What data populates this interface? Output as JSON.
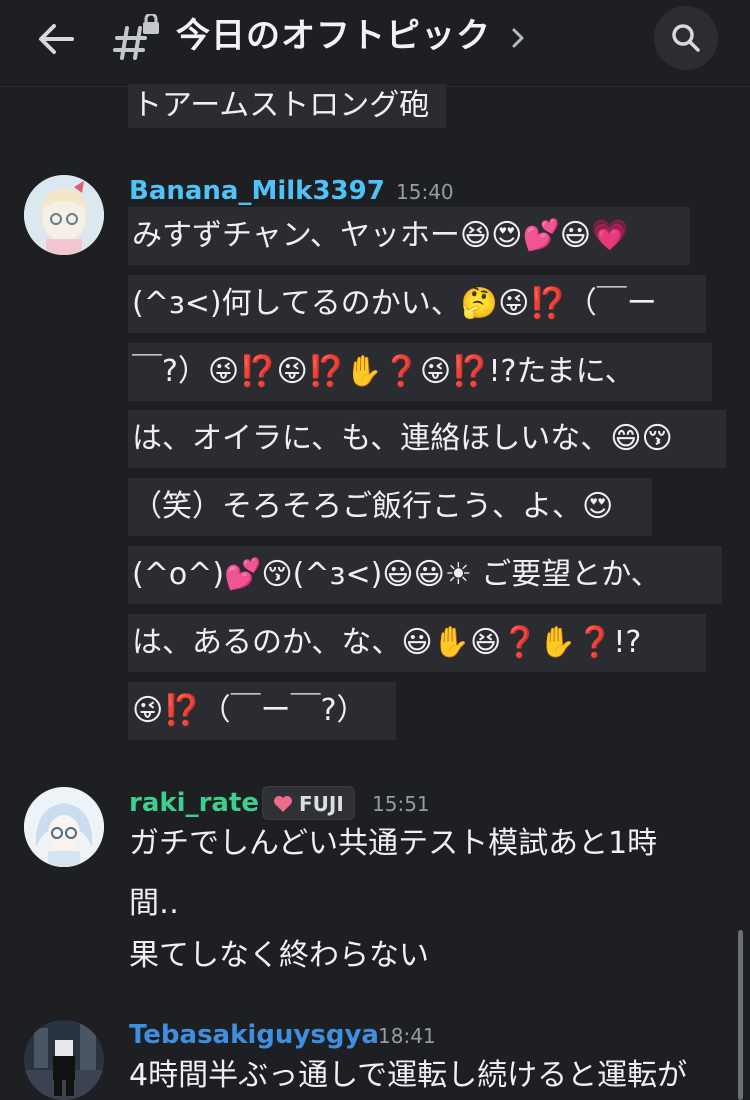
{
  "header": {
    "title": "今日のオフトピック",
    "icons": {
      "back": "arrow-left-icon",
      "channel": "locked-hash-icon",
      "chevron": "chevron-right-icon",
      "search": "search-icon"
    }
  },
  "messages": [
    {
      "continued_line": "トアームストロング砲"
    },
    {
      "username": "Banana_Milk3397",
      "username_color": "#4fc3f7",
      "time": "15:40",
      "lines": [
        "みすずチャン、ヤッホー😆😍💕😃💗",
        "(^з<)何してるのかい、🤔😜⁉️（￣ー",
        "￣?）😜⁉️😜⁉️✋❓😜⁉️!?たまに、",
        "は、オイラに、も、連絡ほしいな、😄😚",
        "（笑）そろそろご飯行こう、よ、😍",
        "(^o^)💕😚(^з<)😃😃☀ ご要望とか、",
        "は、あるのか、な、😃✋😆❓✋❓!?",
        "😜⁉️（￣ー￣?）"
      ]
    },
    {
      "username": "raki_rate",
      "username_color": "#3ecf8e",
      "badge": "FUJI",
      "time": "15:51",
      "lines": [
        "ガチでしんどい共通テスト模試あと1時",
        "間‥",
        "果てしなく終わらない"
      ]
    },
    {
      "username": "Tebasakiguysgya",
      "username_color": "#3f8fe0",
      "time": "18:41",
      "lines": [
        "4時間半ぶっ通しで運転し続けると運転が"
      ]
    }
  ]
}
